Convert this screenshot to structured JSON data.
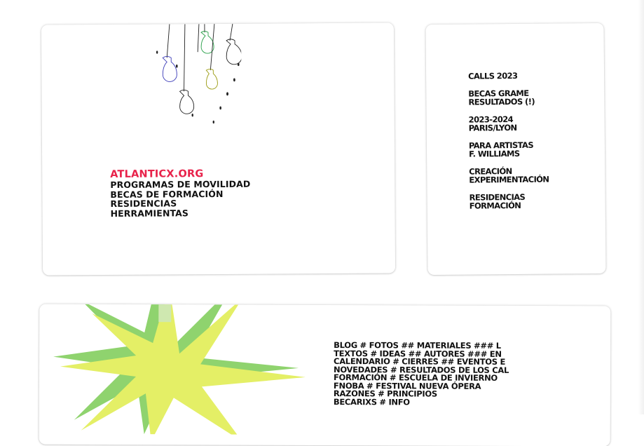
{
  "colors": {
    "accent": "#e8224a",
    "star_yellow": "#e4ef66",
    "star_green": "#8fd36e"
  },
  "intro": {
    "title": "ATLANTICX.ORG",
    "lines": [
      "PROGRAMAS DE MOVILIDAD",
      "BECAS DE FORMACIÓN",
      "RESIDENCIAS",
      "HERRAMIENTAS"
    ]
  },
  "menu": [
    {
      "line1": "CALLS 2023",
      "line2": ""
    },
    {
      "line1": "BECAS GRAME",
      "line2": "RESULTADOS (!)"
    },
    {
      "line1": "2023-2024",
      "line2": "PARIS/LYON"
    },
    {
      "line1": "PARA ARTISTAS",
      "line2": "F. WILLIAMS"
    },
    {
      "line1": "CREACIÓN",
      "line2": "EXPERIMENTACIÓN"
    },
    {
      "line1": "RESIDENCIAS",
      "line2": "FORMACIÓN"
    }
  ],
  "tags": [
    "BLOG  # FOTOS ## MATERIALES ### L",
    "TEXTOS  # IDEAS ## AUTORES ### EN",
    "CALENDARIO  # CIERRES ## EVENTOS E",
    "NOVEDADES # RESULTADOS DE LOS CAL",
    "FORMACIÓN # ESCUELA DE INVIERNO",
    "FNOBA # FESTIVAL NUEVA ÓPERA",
    "RAZONES # PRINCIPIOS",
    "BECARIXS # INFO"
  ]
}
